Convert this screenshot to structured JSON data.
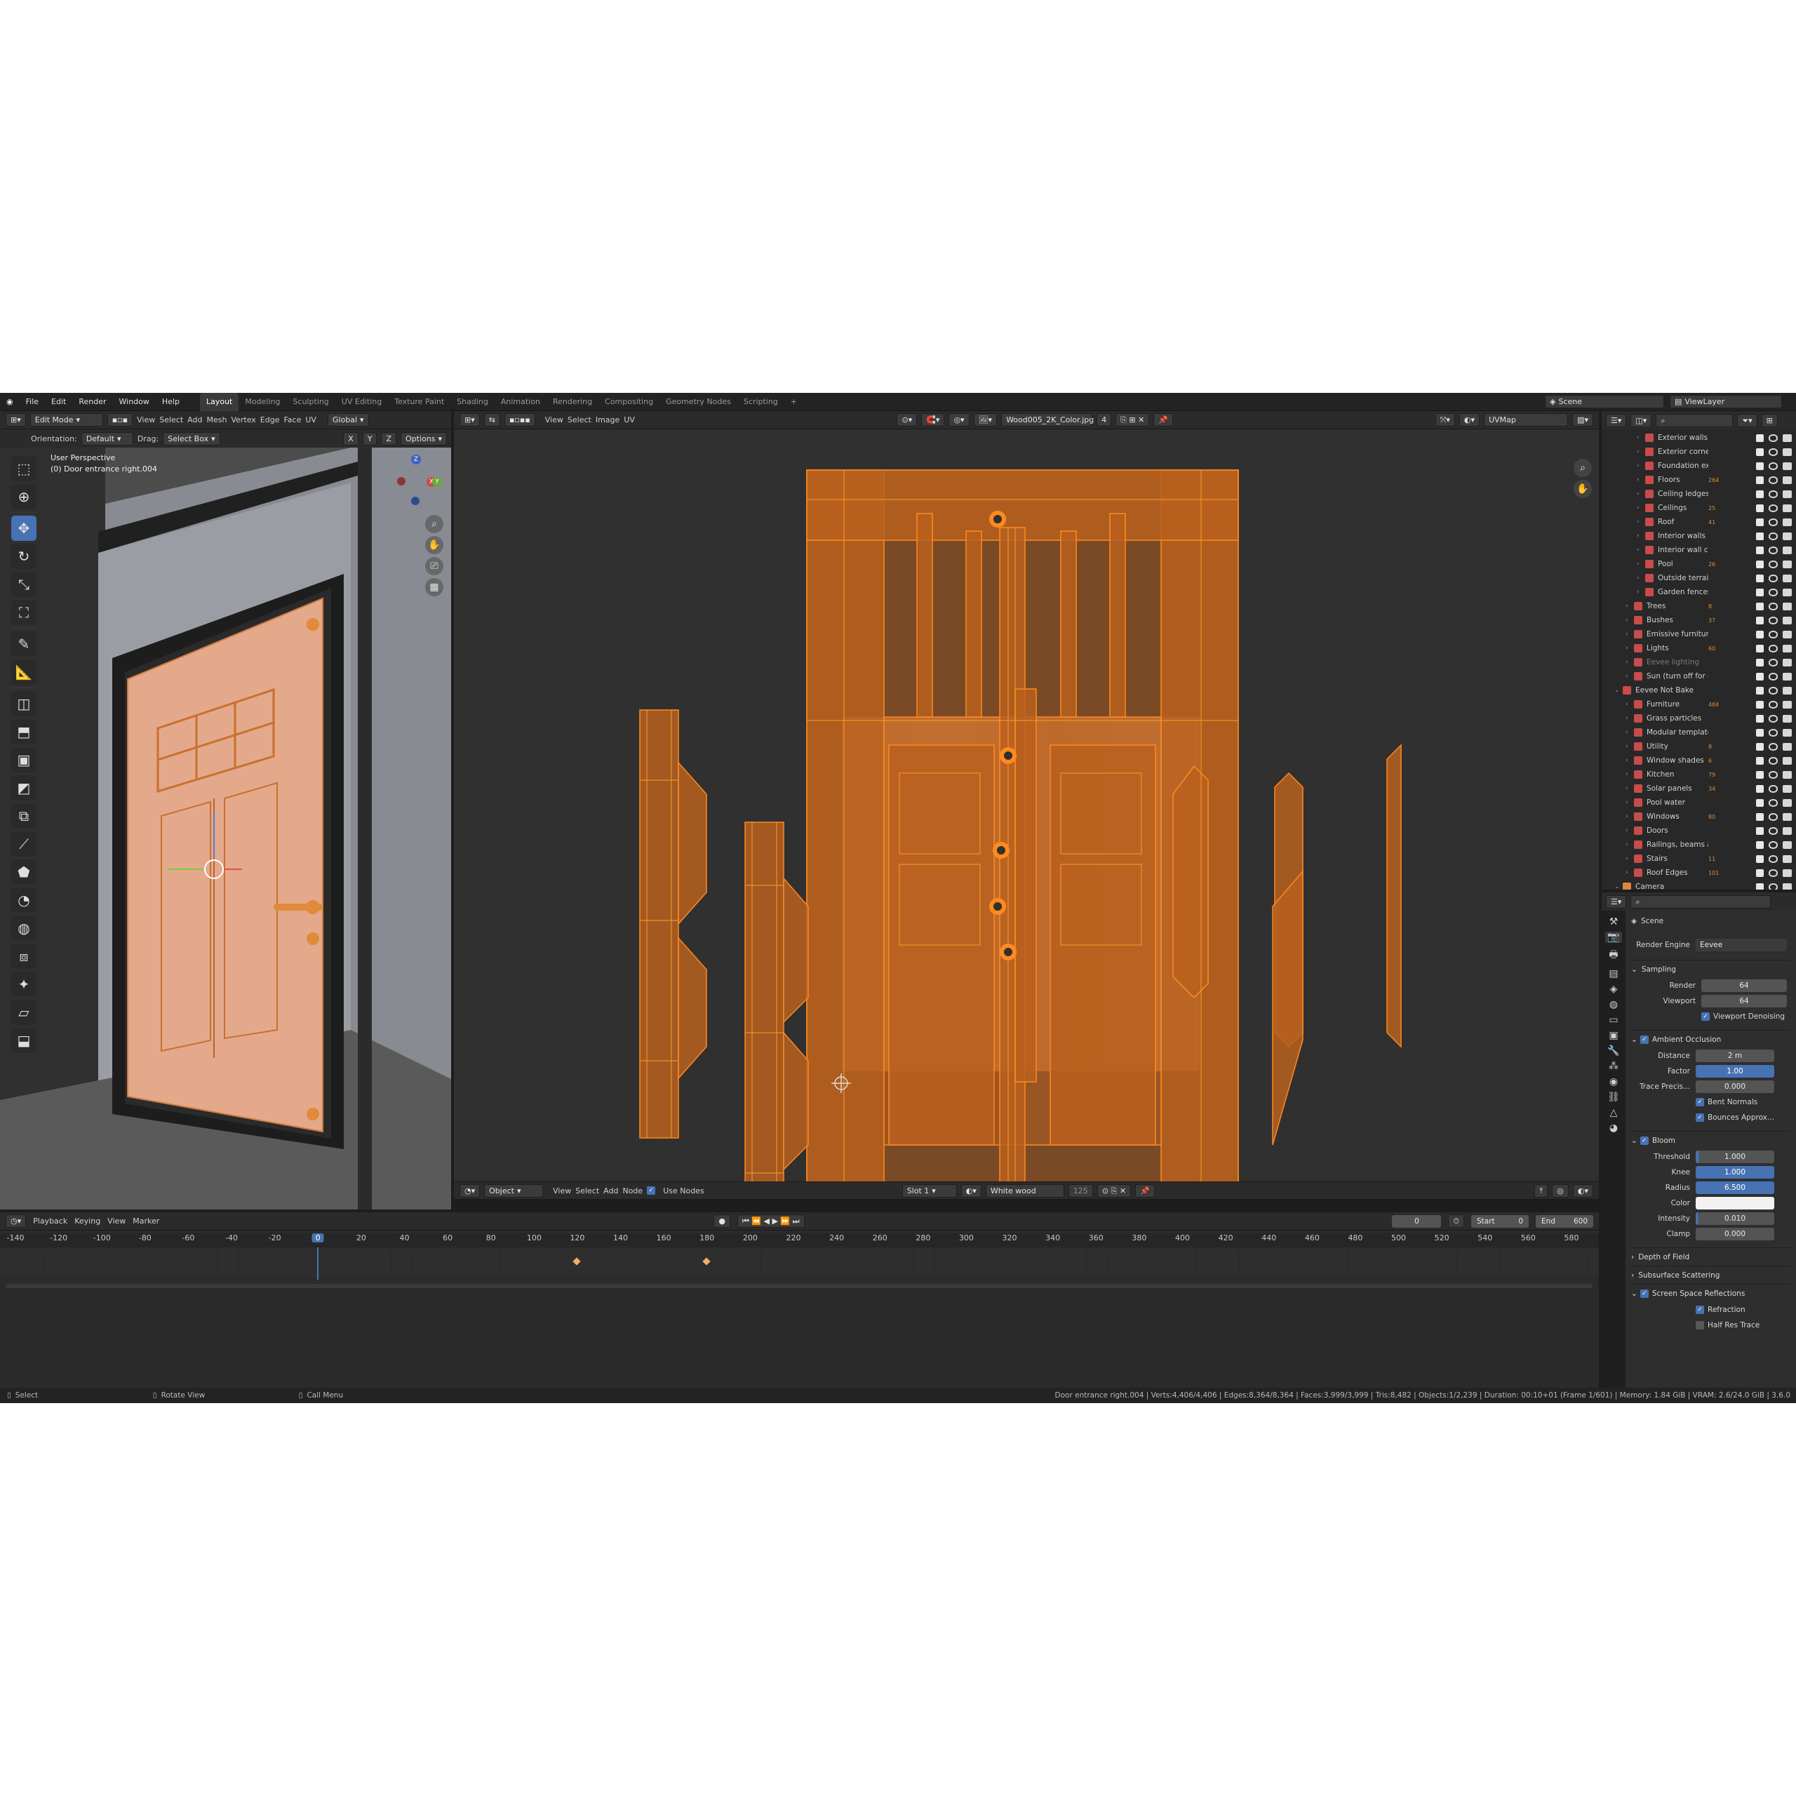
{
  "topbar": {
    "menus": [
      "File",
      "Edit",
      "Render",
      "Window",
      "Help"
    ],
    "workspaces": [
      "Layout",
      "Modeling",
      "Sculpting",
      "UV Editing",
      "Texture Paint",
      "Shading",
      "Animation",
      "Rendering",
      "Compositing",
      "Geometry Nodes",
      "Scripting"
    ],
    "active_workspace": "Layout",
    "add_tab": "+",
    "scene": "Scene",
    "view_layer": "ViewLayer"
  },
  "viewport": {
    "mode": "Edit Mode",
    "menus": [
      "View",
      "Select",
      "Add",
      "Mesh",
      "Vertex",
      "Edge",
      "Face",
      "UV"
    ],
    "transform": "Global",
    "orientation_label": "Orientation:",
    "orientation_value": "Default",
    "drag_label": "Drag:",
    "drag_value": "Select Box",
    "axes": [
      "X",
      "Y",
      "Z"
    ],
    "options": "Options",
    "overlay_title": "User Perspective",
    "overlay_object": "(0) Door entrance right.004"
  },
  "uv_editor": {
    "menus": [
      "View",
      "Select",
      "Image",
      "UV"
    ],
    "image_name": "Wood005_2K_Color.jpg",
    "users": "4",
    "uvmap": "UVMap"
  },
  "node_editor": {
    "type": "Object",
    "menus": [
      "View",
      "Select",
      "Add",
      "Node"
    ],
    "use_nodes_label": "Use Nodes",
    "slot": "Slot 1",
    "material": "White wood",
    "material_users": "125"
  },
  "timeline": {
    "menus": [
      "Playback",
      "Keying",
      "View",
      "Marker"
    ],
    "current_frame": "0",
    "start_label": "Start",
    "start": "0",
    "end_label": "End",
    "end": "600",
    "ticks": [
      "-140",
      "-120",
      "-100",
      "-80",
      "-60",
      "-40",
      "-20",
      "0",
      "20",
      "40",
      "60",
      "80",
      "100",
      "120",
      "140",
      "160",
      "180",
      "200",
      "220",
      "240",
      "260",
      "280",
      "300",
      "320",
      "340",
      "360",
      "380",
      "400",
      "420",
      "440",
      "460",
      "480",
      "500",
      "520",
      "540",
      "560",
      "580"
    ],
    "active_tick": "0"
  },
  "statusbar": {
    "select": "Select",
    "rotate": "Rotate View",
    "call_menu": "Call Menu",
    "stats": "Door entrance right.004 | Verts:4,406/4,406 | Edges:8,364/8,364 | Faces:3,999/3,999 | Tris:8,482 | Objects:1/2,239 | Duration: 00:10+01 (Frame 1/601) | Memory: 1.84 GiB | VRAM: 2.6/24.0 GiB | 3.6.0"
  },
  "outliner": {
    "items": [
      {
        "name": "Exterior walls",
        "indent": 2
      },
      {
        "name": "Exterior corner p",
        "indent": 2
      },
      {
        "name": "Foundation exter",
        "indent": 2
      },
      {
        "name": "Floors",
        "indent": 2,
        "badge": "264"
      },
      {
        "name": "Ceiling ledges",
        "indent": 2
      },
      {
        "name": "Ceilings",
        "indent": 2,
        "badge": "25"
      },
      {
        "name": "Roof",
        "indent": 2,
        "badge": "41"
      },
      {
        "name": "Interior walls",
        "indent": 2
      },
      {
        "name": "Interior wall corn",
        "indent": 2
      },
      {
        "name": "Pool",
        "indent": 2,
        "badge": "26"
      },
      {
        "name": "Outside terrain",
        "indent": 2
      },
      {
        "name": "Garden fences",
        "indent": 2
      },
      {
        "name": "Trees",
        "indent": 1,
        "badge": "8"
      },
      {
        "name": "Bushes",
        "indent": 1,
        "badge": "37"
      },
      {
        "name": "Emissive furniture",
        "indent": 1
      },
      {
        "name": "Lights",
        "indent": 1,
        "badge": "60"
      },
      {
        "name": "Eevee lighting",
        "indent": 1,
        "dim": true
      },
      {
        "name": "Sun (turn off for cycle",
        "indent": 1
      },
      {
        "name": "Eevee Not Bake",
        "indent": 0
      },
      {
        "name": "Furniture",
        "indent": 1,
        "badge": "484"
      },
      {
        "name": "Grass particles",
        "indent": 1
      },
      {
        "name": "Modular template",
        "indent": 1
      },
      {
        "name": "Utility",
        "indent": 1,
        "badge": "8"
      },
      {
        "name": "Window shades",
        "indent": 1,
        "badge": "6"
      },
      {
        "name": "Kitchen",
        "indent": 1,
        "badge": "79"
      },
      {
        "name": "Solar panels",
        "indent": 1,
        "badge": "34"
      },
      {
        "name": "Pool water",
        "indent": 1
      },
      {
        "name": "Windows",
        "indent": 1,
        "badge": "80"
      },
      {
        "name": "Doors",
        "indent": 1
      },
      {
        "name": "Railings, beams and",
        "indent": 1
      },
      {
        "name": "Stairs",
        "indent": 1,
        "badge": "11"
      },
      {
        "name": "Roof Edges",
        "indent": 1,
        "badge": "101"
      },
      {
        "name": "Camera",
        "indent": 0
      }
    ]
  },
  "properties": {
    "scene": "Scene",
    "render_engine_label": "Render Engine",
    "render_engine": "Eevee",
    "sampling": {
      "title": "Sampling",
      "render_label": "Render",
      "render": "64",
      "viewport_label": "Viewport",
      "viewport": "64",
      "denoise": "Viewport Denoising"
    },
    "ao": {
      "title": "Ambient Occlusion",
      "distance_label": "Distance",
      "distance": "2 m",
      "factor_label": "Factor",
      "factor": "1.00",
      "trace_label": "Trace Precis...",
      "trace": "0.000",
      "bent": "Bent Normals",
      "bounces": "Bounces Approx..."
    },
    "bloom": {
      "title": "Bloom",
      "threshold_label": "Threshold",
      "threshold": "1.000",
      "knee_label": "Knee",
      "knee": "1.000",
      "radius_label": "Radius",
      "radius": "6.500",
      "color_label": "Color",
      "intensity_label": "Intensity",
      "intensity": "0.010",
      "clamp_label": "Clamp",
      "clamp": "0.000"
    },
    "dof": "Depth of Field",
    "sss": "Subsurface Scattering",
    "ssr": {
      "title": "Screen Space Reflections",
      "refraction": "Refraction",
      "half_res": "Half Res Trace"
    }
  },
  "colors": {
    "accent": "#4772b3",
    "uv_orange": "#b8601f",
    "uv_edge": "#ff8a1f",
    "door": "#e3a98a"
  }
}
